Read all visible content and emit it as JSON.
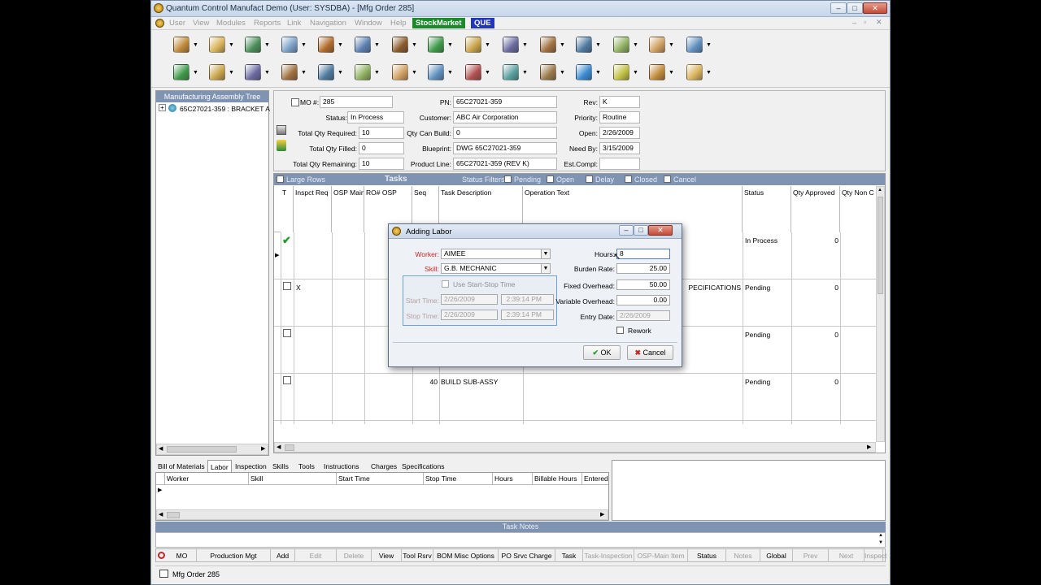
{
  "window": {
    "title": "Quantum Control Manufact Demo (User: SYSDBA) - [Mfg Order 285]"
  },
  "menu": [
    "User",
    "View",
    "Modules",
    "Reports",
    "Link",
    "Navigation",
    "Window",
    "Help"
  ],
  "menu_highlights": [
    {
      "label": "StockMarket",
      "color": "#1a8a2a"
    },
    {
      "label": "QUE",
      "color": "#2236b8"
    }
  ],
  "tree": {
    "header": "Manufacturing Assembly Tree",
    "node": "65C27021-359 : BRACKET A"
  },
  "mo": {
    "mo_label": "MO #:",
    "mo": "285",
    "pn_label": "PN:",
    "pn": "65C27021-359",
    "rev_label": "Rev:",
    "rev": "K",
    "status_label": "Status:",
    "status": "In Process",
    "customer_label": "Customer:",
    "customer": "ABC Air Corporation",
    "priority_label": "Priority:",
    "priority": "Routine",
    "qty_required_label": "Total Qty Required:",
    "qty_required": "10",
    "qty_can_build_label": "Qty Can Build:",
    "qty_can_build": "0",
    "open_label": "Open:",
    "open": "2/26/2009",
    "qty_filled_label": "Total Qty Filled:",
    "qty_filled": "0",
    "blueprint_label": "Blueprint:",
    "blueprint": "DWG 65C27021-359",
    "need_by_label": "Need By:",
    "need_by": "3/15/2009",
    "qty_remaining_label": "Total Qty Remaining:",
    "qty_remaining": "10",
    "product_line_label": "Product Line:",
    "product_line": "65C27021-359 (REV K)",
    "est_compl_label": "Est.Compl:",
    "est_compl": ""
  },
  "tasks": {
    "large_rows": "Large Rows",
    "title": "Tasks",
    "status_filters": "Status Filters:",
    "filters": [
      {
        "label": "Pending",
        "checked": true
      },
      {
        "label": "Open",
        "checked": true
      },
      {
        "label": "Delay",
        "checked": true
      },
      {
        "label": "Closed",
        "checked": false
      },
      {
        "label": "Cancel",
        "checked": false
      }
    ],
    "columns": [
      "T",
      "Inspct Req",
      "OSP Main",
      "RO# OSP",
      "Seq",
      "Task Description",
      "Operation Text",
      "Status",
      "Qty Approved",
      "Qty Non C"
    ],
    "rows": [
      {
        "mark": "check",
        "inspct": "",
        "seq": "",
        "desc": "",
        "op": "",
        "status": "In Process",
        "qty": "0"
      },
      {
        "mark": "box",
        "inspct": "X",
        "seq": "",
        "desc": "",
        "op": "PECIFICATIONS",
        "status": "Pending",
        "qty": "0"
      },
      {
        "mark": "box",
        "inspct": "",
        "seq": "",
        "desc": "",
        "op": "",
        "status": "Pending",
        "qty": "0"
      },
      {
        "mark": "box",
        "inspct": "",
        "seq": "40",
        "desc": "BUILD SUB-ASSY",
        "op": "",
        "status": "Pending",
        "qty": "0"
      }
    ]
  },
  "bottom_tabs": [
    "Bill of Materials",
    "Labor",
    "Inspection",
    "Skills",
    "Tools",
    "Instructions",
    "Charges",
    "Specifications"
  ],
  "labor_columns": [
    "Worker",
    "Skill",
    "Start Time",
    "Stop Time",
    "Hours",
    "Billable Hours",
    "Entered"
  ],
  "task_notes": "Task Notes",
  "bottom_buttons": [
    {
      "label": "MO",
      "enabled": true
    },
    {
      "label": "Production Mgt",
      "enabled": true
    },
    {
      "label": "Add",
      "enabled": true
    },
    {
      "label": "Edit",
      "enabled": false
    },
    {
      "label": "Delete",
      "enabled": false
    },
    {
      "label": "View",
      "enabled": true
    },
    {
      "label": "Tool Rsrv",
      "enabled": true
    },
    {
      "label": "BOM Misc Options",
      "enabled": true
    },
    {
      "label": "PO Srvc Charge",
      "enabled": true
    },
    {
      "label": "Task",
      "enabled": true
    },
    {
      "label": "Task-Inspection",
      "enabled": false
    },
    {
      "label": "OSP-Main Item",
      "enabled": false
    },
    {
      "label": "Status",
      "enabled": true
    },
    {
      "label": "Notes",
      "enabled": false
    },
    {
      "label": "Global",
      "enabled": true
    },
    {
      "label": "Prev",
      "enabled": false
    },
    {
      "label": "Next",
      "enabled": false
    },
    {
      "label": "Inspect",
      "enabled": false
    }
  ],
  "statusbar": {
    "window_label": "Mfg Order 285"
  },
  "dialog": {
    "title": "Adding Labor",
    "worker_label": "Worker:",
    "worker": "AIMEE",
    "skill_label": "Skill:",
    "skill": "G.B. MECHANIC",
    "use_start_stop": "Use Start-Stop Time",
    "start_time_label": "Start Time:",
    "start_date": "2/26/2009",
    "start_clock": "2:39:14 PM",
    "stop_time_label": "Stop Time:",
    "stop_date": "2/26/2009",
    "stop_clock": "2:39:14 PM",
    "hours_label": "Hours:",
    "hours": "8",
    "burden_rate_label": "Burden Rate:",
    "burden_rate": "25.00",
    "fixed_overhead_label": "Fixed Overhead:",
    "fixed_overhead": "50.00",
    "variable_overhead_label": "Variable Overhead:",
    "variable_overhead": "0.00",
    "entry_date_label": "Entry Date:",
    "entry_date": "2/26/2009",
    "rework_label": "Rework",
    "ok_label": "OK",
    "cancel_label": "Cancel"
  }
}
